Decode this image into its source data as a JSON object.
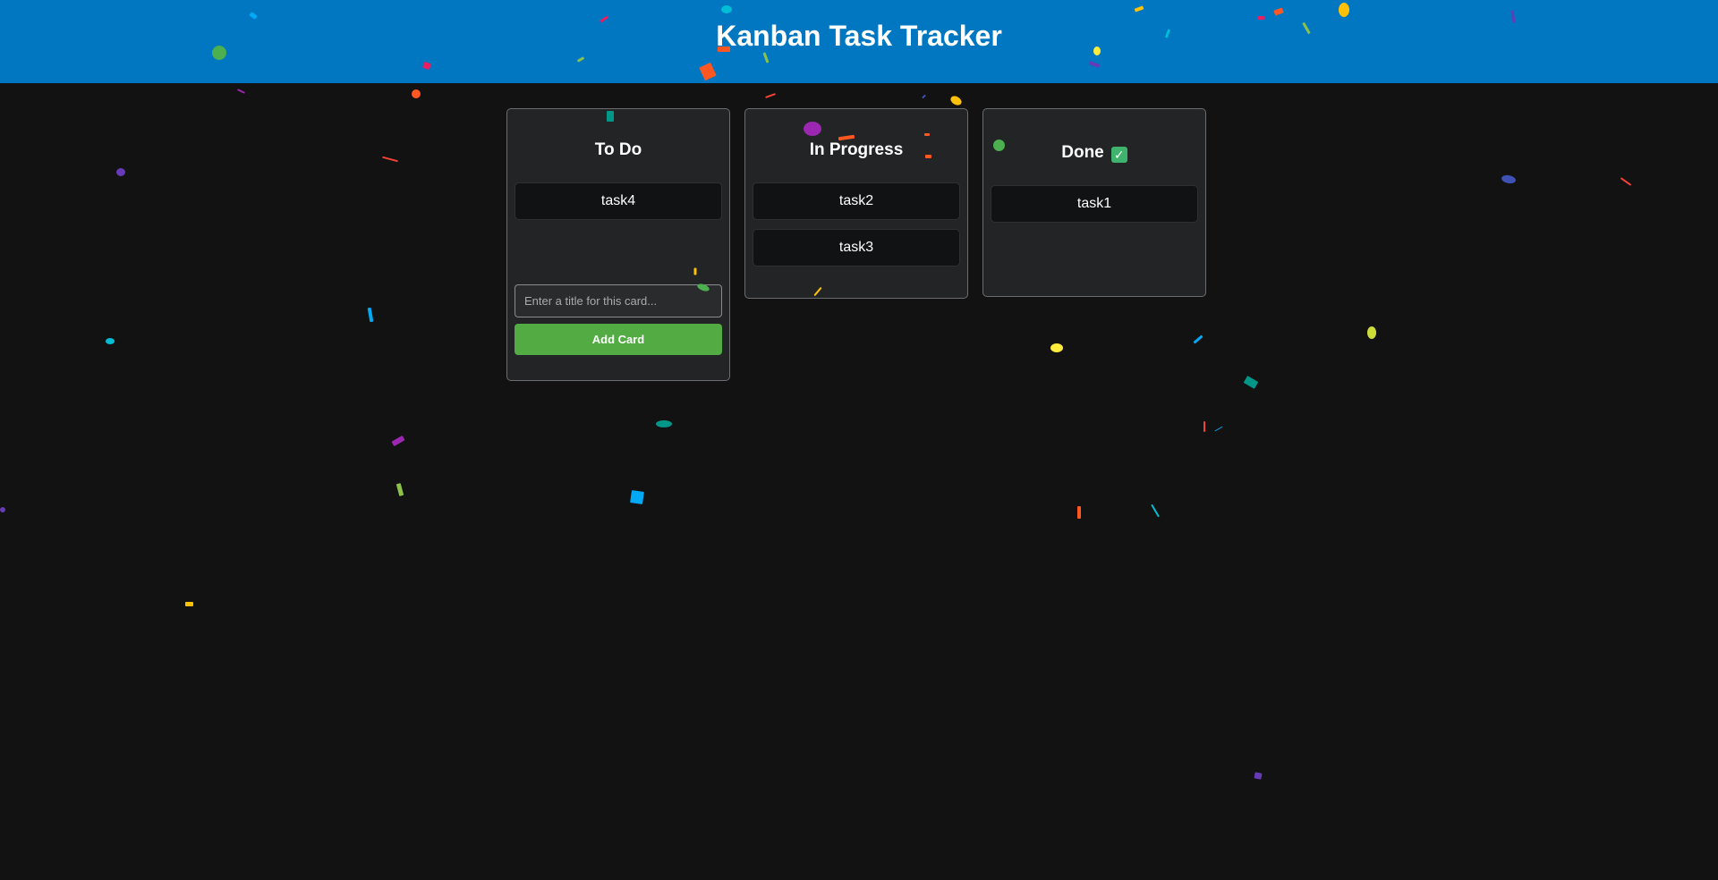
{
  "app": {
    "title": "Kanban Task Tracker"
  },
  "columns": {
    "todo": {
      "title": "To Do",
      "cards": [
        "task4"
      ],
      "input_placeholder": "Enter a title for this card...",
      "add_button_label": "Add Card"
    },
    "in_progress": {
      "title": "In Progress",
      "cards": [
        "task2",
        "task3"
      ]
    },
    "done": {
      "title": "Done",
      "badge": "✓",
      "cards": [
        "task1"
      ]
    }
  },
  "colors": {
    "header": "#0077c0",
    "background": "#121212",
    "column": "#232426",
    "add_button": "#52ac43",
    "done_check": "#3fb36d",
    "confetti": [
      "#4caf50",
      "#e91e63",
      "#ff5722",
      "#ffc107",
      "#9c27b0",
      "#03a9f4",
      "#00bcd4",
      "#8bc34a",
      "#3f51b5",
      "#cddc39",
      "#009688",
      "#673ab7",
      "#f44336",
      "#ffeb3b",
      "#2196f3"
    ]
  }
}
